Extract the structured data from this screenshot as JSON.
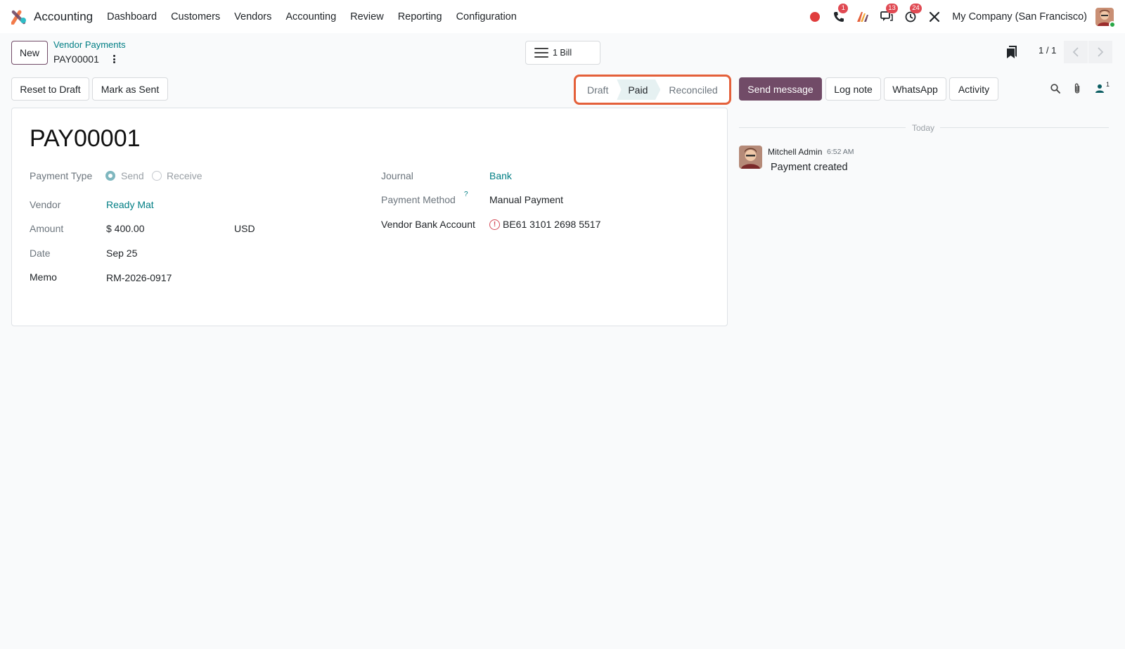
{
  "app": {
    "title": "Accounting"
  },
  "nav": {
    "items": [
      "Dashboard",
      "Customers",
      "Vendors",
      "Accounting",
      "Review",
      "Reporting",
      "Configuration"
    ]
  },
  "systray": {
    "phone_badge": "1",
    "messages_badge": "13",
    "activities_badge": "24",
    "company": "My Company (San Francisco)"
  },
  "control": {
    "new_label": "New",
    "breadcrumb": "Vendor Payments",
    "record": "PAY00001",
    "smart_button": "1 Bill",
    "pager": "1 / 1"
  },
  "actions": {
    "reset": "Reset to Draft",
    "mark_sent": "Mark as Sent"
  },
  "status": {
    "stages": [
      "Draft",
      "Paid",
      "Reconciled"
    ],
    "active": "Paid"
  },
  "chatter": {
    "send": "Send message",
    "log": "Log note",
    "whatsapp": "WhatsApp",
    "activity": "Activity",
    "followers": "1",
    "divider": "Today",
    "message": {
      "author": "Mitchell Admin",
      "time": "6:52 AM",
      "body": "Payment created"
    }
  },
  "form": {
    "title": "PAY00001",
    "payment_type_label": "Payment Type",
    "send_label": "Send",
    "receive_label": "Receive",
    "vendor_label": "Vendor",
    "vendor": "Ready Mat",
    "amount_label": "Amount",
    "amount": "$ 400.00",
    "currency": "USD",
    "date_label": "Date",
    "date": "Sep 25",
    "memo_label": "Memo",
    "memo": "RM-2026-0917",
    "journal_label": "Journal",
    "journal": "Bank",
    "method_label": "Payment Method",
    "method_help": "?",
    "method": "Manual Payment",
    "bank_label": "Vendor Bank Account",
    "bank": "BE61 3101 2698 5517"
  },
  "colors": {
    "primary": "#714b67",
    "link": "#017e84",
    "highlight": "#e4603a",
    "badge": "#e04a53"
  }
}
